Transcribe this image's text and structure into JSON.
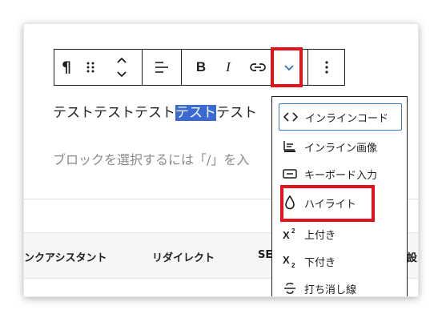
{
  "paragraph": {
    "before": "テストテストテスト",
    "selected": "テスト",
    "after": "テスト"
  },
  "placeholder": "ブロックを選択するには「/」を入",
  "tabs": [
    "ンクアシスタント",
    "リダイレクト",
    "SE",
    "設"
  ],
  "toolbar": {
    "paragraph_symbol": "¶",
    "bold_label": "B",
    "italic_label": "I"
  },
  "menu": {
    "items": [
      {
        "label": "インラインコード",
        "icon": "code-icon"
      },
      {
        "label": "インライン画像",
        "icon": "image-icon"
      },
      {
        "label": "キーボード入力",
        "icon": "keyboard-icon"
      },
      {
        "label": "ハイライト",
        "icon": "droplet-icon"
      },
      {
        "label": "上付き",
        "icon": "superscript-icon"
      },
      {
        "label": "下付き",
        "icon": "subscript-icon"
      },
      {
        "label": "打ち消し線",
        "icon": "strikethrough-icon"
      }
    ]
  },
  "colors": {
    "highlight_border": "#e3131b",
    "selection": "#3a69d4",
    "focus": "#3a78c9",
    "chevron": "#2f6fbf"
  }
}
